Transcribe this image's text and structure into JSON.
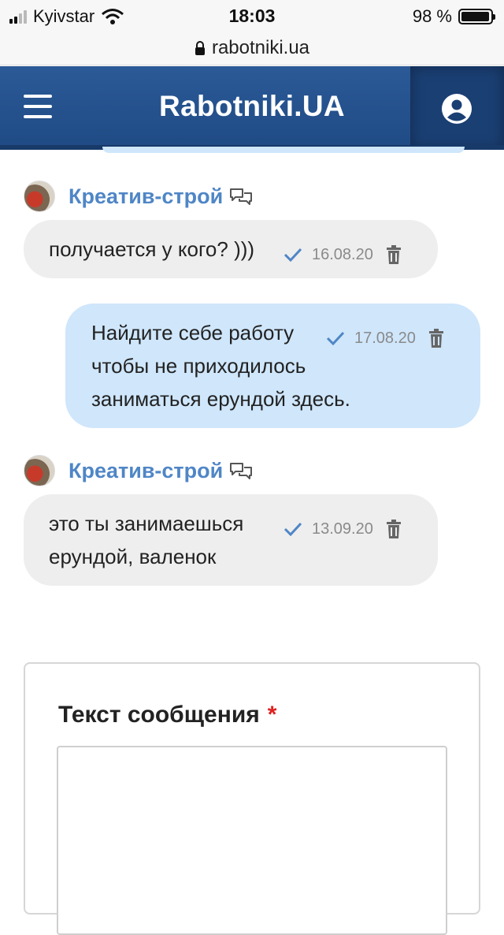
{
  "status_bar": {
    "carrier": "Kyivstar",
    "time": "18:03",
    "battery_percent": "98 %",
    "battery_level": 0.98,
    "signal_bars": 2
  },
  "browser": {
    "url": "rabotniki.ua"
  },
  "header": {
    "brand": "Rabotniki.UA",
    "menu_icon": "hamburger-icon",
    "profile_icon": "user-circle-icon",
    "color": "#2b5a97"
  },
  "colors": {
    "sender_name": "#4f86c6",
    "incoming_bubble": "#eeeeee",
    "outgoing_bubble": "#cfe6fb",
    "check": "#4f86c6",
    "required": "#e02020"
  },
  "messages": [
    {
      "sender": "Креатив-строй",
      "direction": "incoming",
      "lines": [
        "получается у кого? )))"
      ],
      "date": "16.08.20"
    },
    {
      "sender": "",
      "direction": "outgoing",
      "lines": [
        "Найдите себе работу",
        "чтобы не приходилось",
        "заниматься ерундой здесь."
      ],
      "date": "17.08.20"
    },
    {
      "sender": "Креатив-строй",
      "direction": "incoming",
      "lines": [
        "это ты занимаешься",
        "ерундой, валенок"
      ],
      "date": "13.09.20"
    }
  ],
  "composer": {
    "label": "Текст сообщения",
    "required_mark": "*",
    "value": ""
  }
}
